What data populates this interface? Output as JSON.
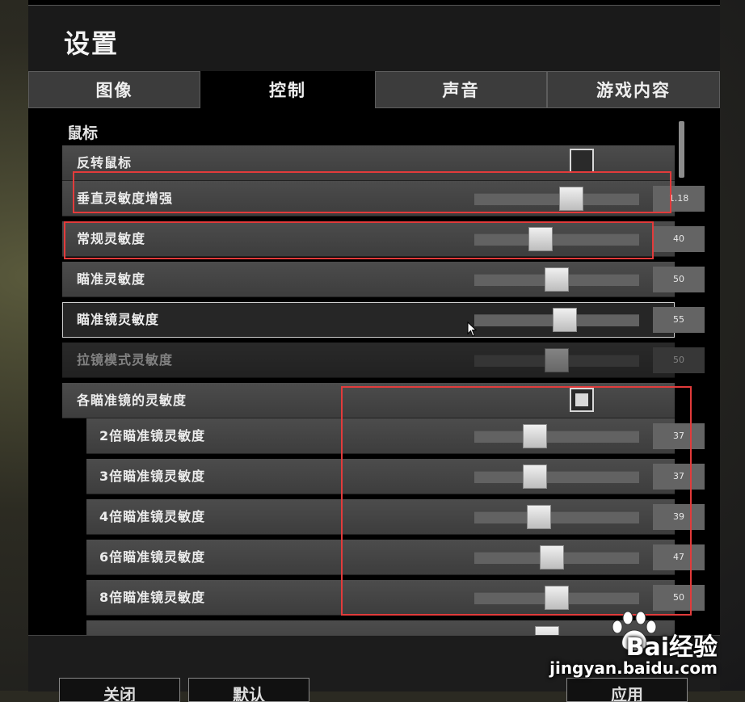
{
  "window": {
    "title": "设置"
  },
  "tabs": [
    {
      "label": "图像",
      "active": false
    },
    {
      "label": "控制",
      "active": true
    },
    {
      "label": "声音",
      "active": false
    },
    {
      "label": "游戏内容",
      "active": false
    }
  ],
  "section": {
    "title": "鼠标"
  },
  "rows": {
    "invert_mouse": {
      "label": "反转鼠标",
      "checked": false
    },
    "vertical_boost": {
      "label": "垂直灵敏度增强",
      "value": "1.18",
      "slider": 0.59
    },
    "general": {
      "label": "常规灵敏度",
      "value": "40",
      "slider": 0.4
    },
    "aim": {
      "label": "瞄准灵敏度",
      "value": "50",
      "slider": 0.5
    },
    "scope": {
      "label": "瞄准镜灵敏度",
      "value": "55",
      "slider": 0.55
    },
    "zoom_mode": {
      "label": "拉镜模式灵敏度",
      "value": "50",
      "slider": 0.5
    },
    "per_scope": {
      "label": "各瞄准镜的灵敏度",
      "checked": true
    },
    "scope_2x": {
      "label": "2倍瞄准镜灵敏度",
      "value": "37",
      "slider": 0.37
    },
    "scope_3x": {
      "label": "3倍瞄准镜灵敏度",
      "value": "37",
      "slider": 0.37
    },
    "scope_4x": {
      "label": "4倍瞄准镜灵敏度",
      "value": "39",
      "slider": 0.39
    },
    "scope_6x": {
      "label": "6倍瞄准镜灵敏度",
      "value": "47",
      "slider": 0.47
    },
    "scope_8x": {
      "label": "8倍瞄准镜灵敏度",
      "value": "50",
      "slider": 0.5
    }
  },
  "footer": {
    "close_label": "关闭",
    "default_label": "默认",
    "apply_label": "应用"
  },
  "watermark": {
    "brand": "Bai经验",
    "url": "jingyan.baidu.com"
  },
  "colors": {
    "highlight": "#e23b3b",
    "panel": "#000000",
    "row": "#444444"
  }
}
